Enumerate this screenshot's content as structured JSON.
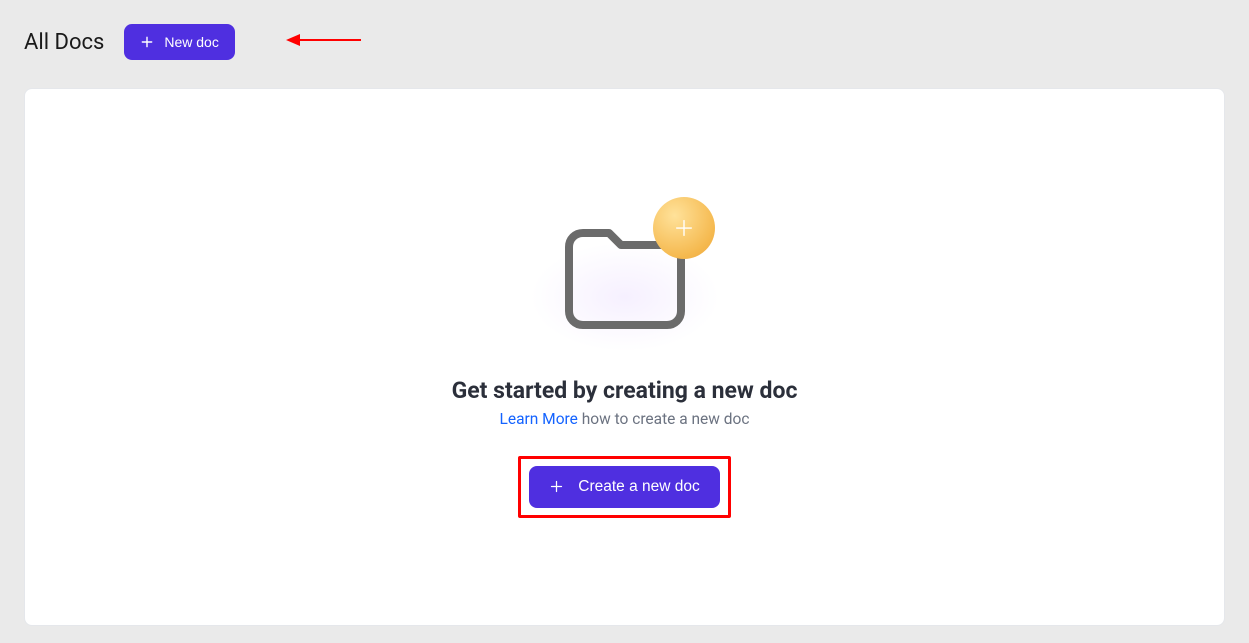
{
  "header": {
    "title": "All Docs",
    "new_doc_label": "New doc"
  },
  "colors": {
    "brand": "#4f2fe0",
    "annotation": "#ff0000",
    "link": "#1463ff"
  },
  "empty_state": {
    "title": "Get started by creating a new doc",
    "learn_more_label": "Learn More",
    "subline_text": "how to create a new doc",
    "cta_label": "Create a new doc"
  }
}
